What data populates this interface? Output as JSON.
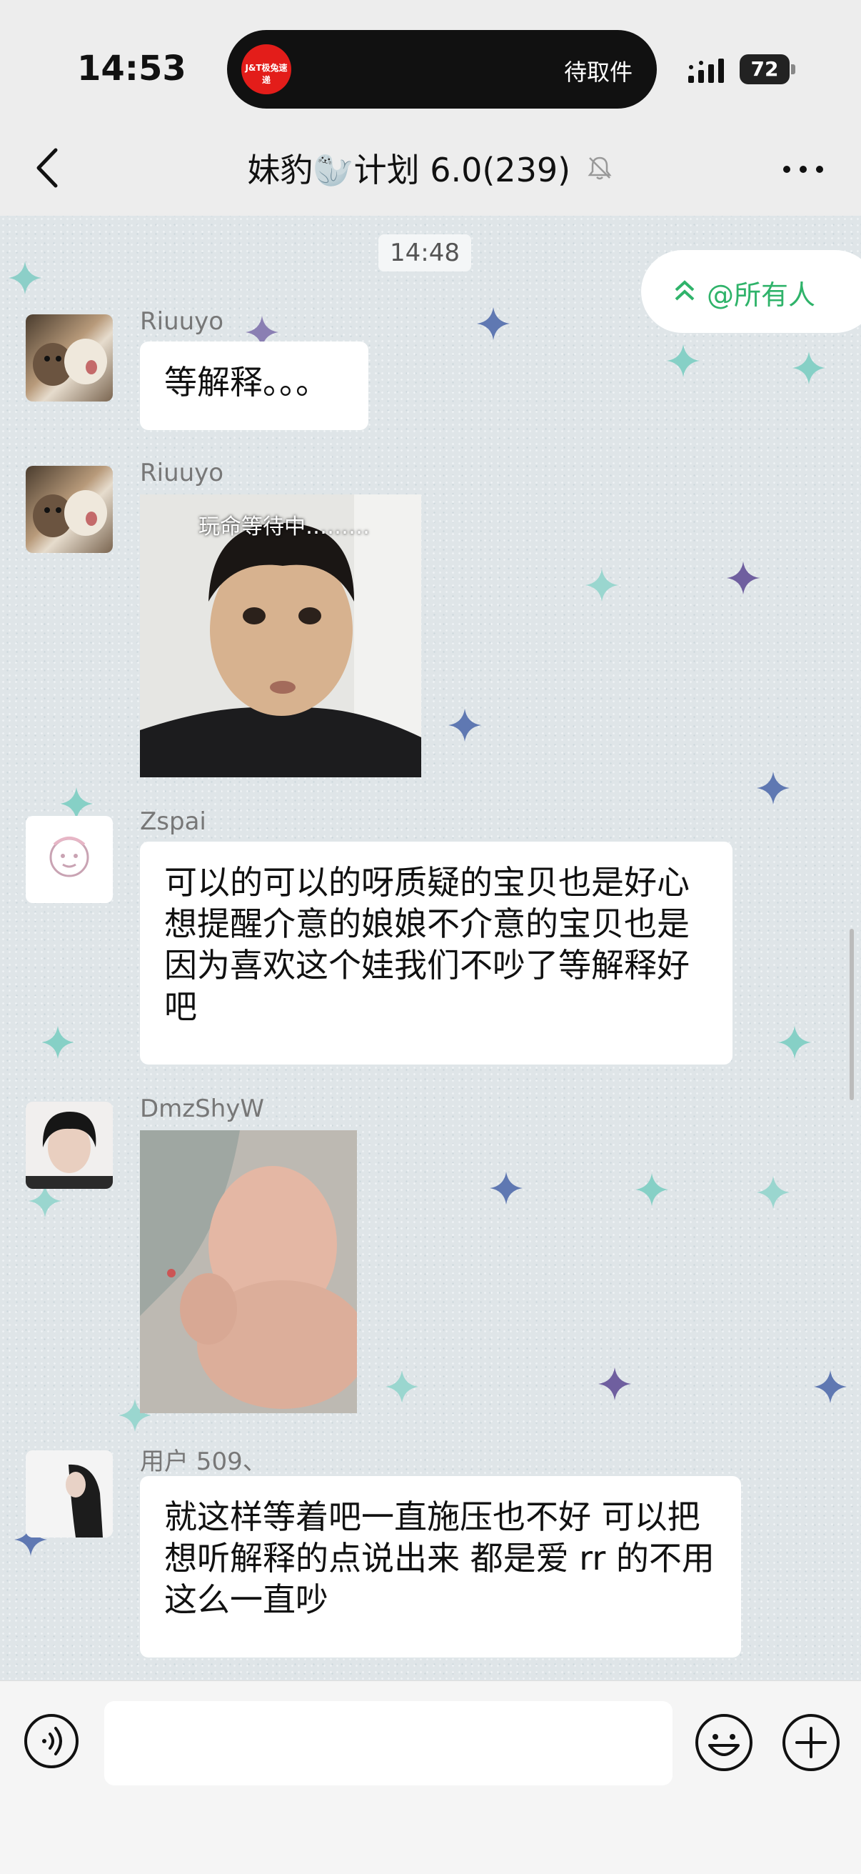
{
  "status_bar": {
    "time": "14:53",
    "island_text": "待取件",
    "island_logo_text": "J&T极兔速递",
    "battery": "72"
  },
  "header": {
    "title": "妹豹🦭计划 6.0(239)"
  },
  "chat": {
    "timestamp": "14:48",
    "at_all_label": "@所有人",
    "messages": [
      {
        "sender": "Riuuyo",
        "text": "等解释。。。"
      },
      {
        "sender": "Riuuyo",
        "image_caption": "玩命等待中………"
      },
      {
        "sender": "Zspai",
        "text": "可以的可以的呀质疑的宝贝也是好心想提醒介意的娘娘不介意的宝贝也是因为喜欢这个娃我们不吵了等解释好吧"
      },
      {
        "sender": "DmzShyW"
      },
      {
        "sender": "用户 509、",
        "text": "就这样等着吧一直施压也不好 可以把想听解释的点说出来  都是爱 rr 的不用这么一直吵"
      }
    ]
  },
  "input": {
    "placeholder": ""
  },
  "colors": {
    "accent_green": "#2fb36a",
    "bubble": "#ffffff",
    "header_bg": "#ededed"
  },
  "icons": [
    "back-icon",
    "mute-icon",
    "more-icon",
    "voice-icon",
    "emoji-icon",
    "plus-icon",
    "double-chevron-up-icon"
  ]
}
